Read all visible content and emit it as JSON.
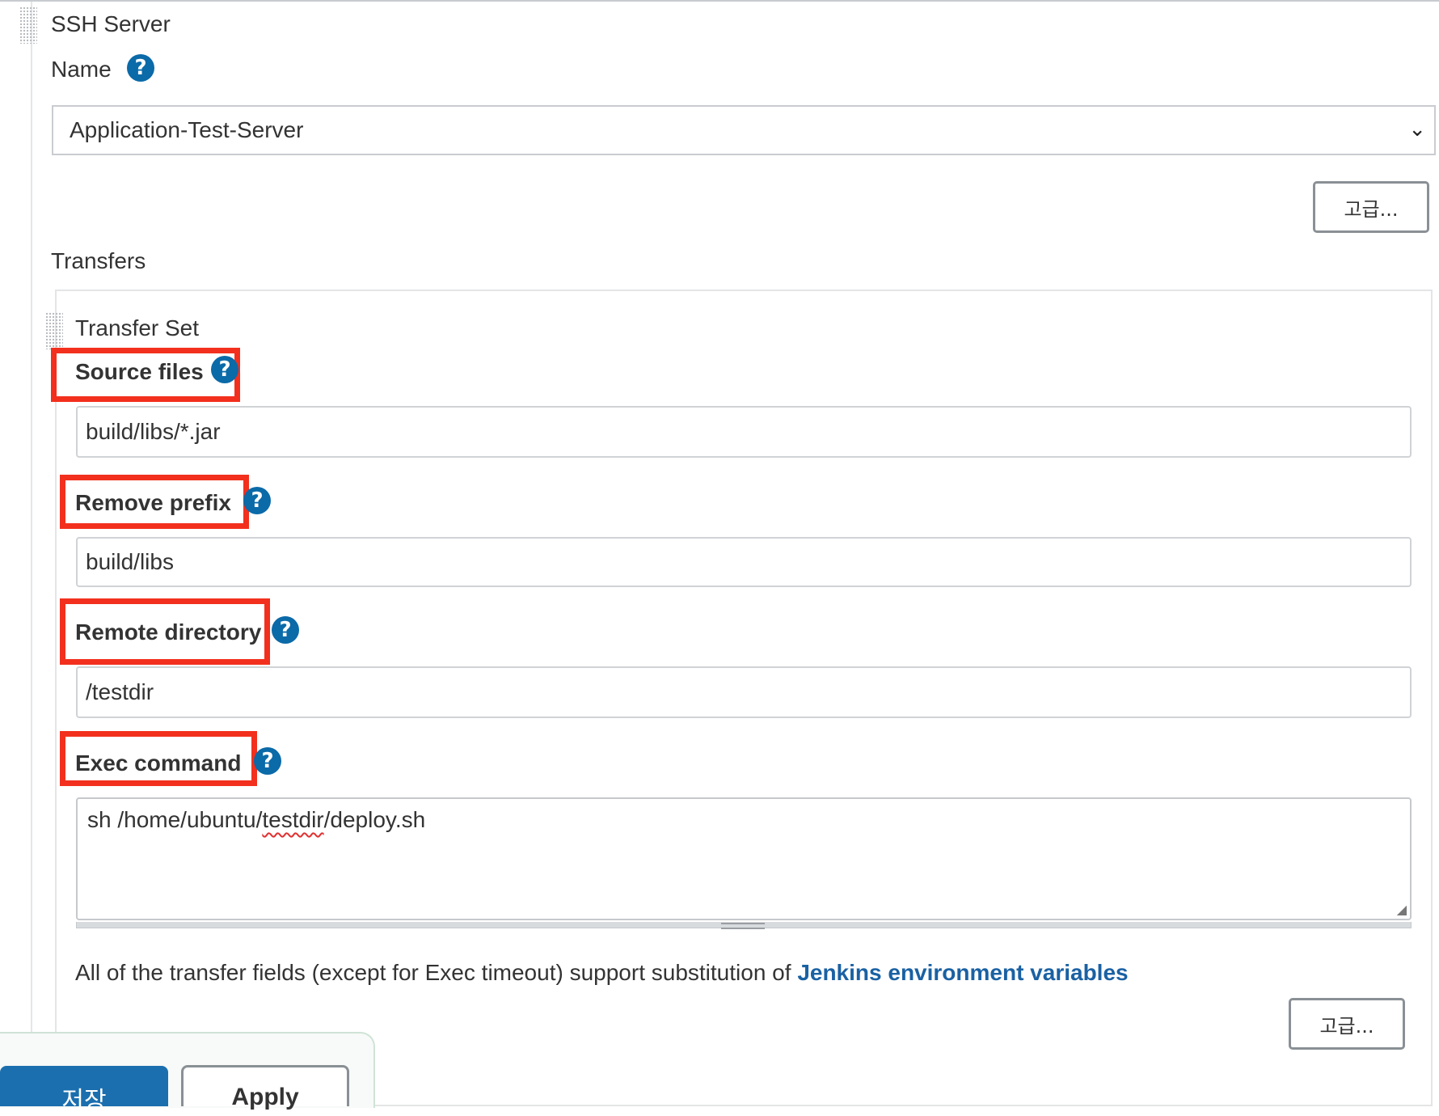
{
  "ssh_server": {
    "section_title": "SSH Server",
    "name_label": "Name",
    "help_glyph": "?",
    "selected_server": "Application-Test-Server",
    "advanced_label": "고급..."
  },
  "transfers": {
    "label": "Transfers",
    "transfer_set": {
      "title": "Transfer Set",
      "source_files": {
        "label": "Source files",
        "value": "build/libs/*.jar"
      },
      "remove_prefix": {
        "label": "Remove prefix",
        "value": "build/libs"
      },
      "remote_directory": {
        "label": "Remote directory",
        "value": "/testdir"
      },
      "exec_command": {
        "label": "Exec command",
        "value_before": "sh /home/ubuntu/",
        "value_misspelled": "testdir",
        "value_after": "/deploy.sh"
      },
      "info_text": "All of the transfer fields (except for Exec timeout) support substitution of ",
      "info_link": "Jenkins environment variables",
      "advanced_label": "고급..."
    }
  },
  "footer": {
    "save_label": "저장",
    "apply_label": "Apply"
  },
  "colors": {
    "help_icon": "#0b6aa8",
    "highlight_box": "#f2301d",
    "link": "#1a61a3",
    "save_button": "#1b6fae"
  }
}
